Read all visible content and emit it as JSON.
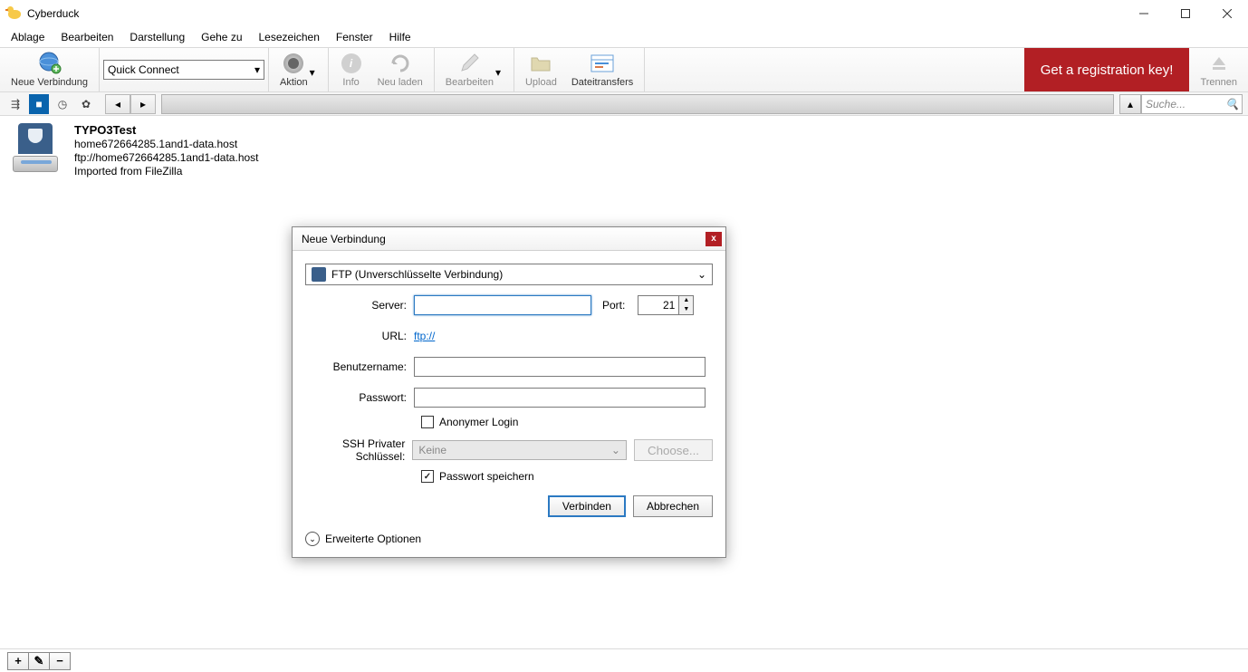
{
  "window": {
    "title": "Cyberduck"
  },
  "menu": {
    "items": [
      "Ablage",
      "Bearbeiten",
      "Darstellung",
      "Gehe zu",
      "Lesezeichen",
      "Fenster",
      "Hilfe"
    ]
  },
  "toolbar": {
    "newconn": "Neue Verbindung",
    "quickconnect": "Quick Connect",
    "aktion": "Aktion",
    "info": "Info",
    "reload": "Neu laden",
    "edit": "Bearbeiten",
    "upload": "Upload",
    "transfers": "Dateitransfers",
    "register": "Get a registration key!",
    "disconnect": "Trennen"
  },
  "search": {
    "placeholder": "Suche..."
  },
  "bookmark": {
    "title": "TYPO3Test",
    "host": "home672664285.1and1-data.host",
    "url": "ftp://home672664285.1and1-data.host",
    "note": "Imported from FileZilla"
  },
  "dialog": {
    "title": "Neue Verbindung",
    "protocol": "FTP (Unverschlüsselte Verbindung)",
    "server_label": "Server:",
    "server_value": "",
    "port_label": "Port:",
    "port_value": "21",
    "url_label": "URL:",
    "url_value": "ftp://",
    "user_label": "Benutzername:",
    "user_value": "",
    "pwd_label": "Passwort:",
    "pwd_value": "",
    "anon_label": "Anonymer Login",
    "ssh_label": "SSH Privater Schlüssel:",
    "ssh_value": "Keine",
    "choose": "Choose...",
    "savepwd_label": "Passwort speichern",
    "connect": "Verbinden",
    "cancel": "Abbrechen",
    "expand": "Erweiterte Optionen"
  },
  "bottombar": {
    "add": "+",
    "edit": "✎",
    "remove": "−"
  }
}
